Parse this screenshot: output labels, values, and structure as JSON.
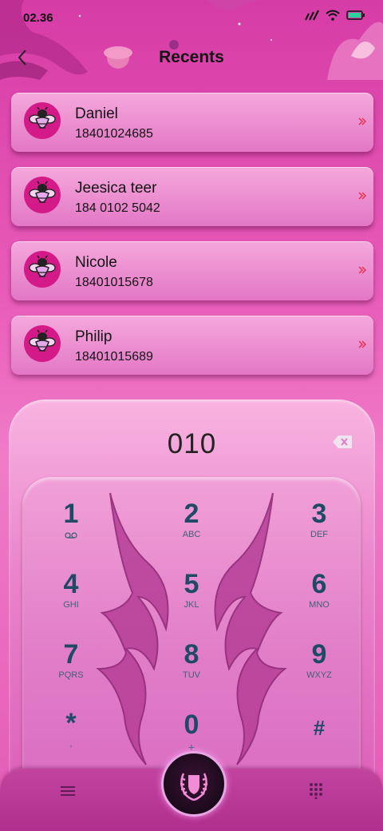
{
  "status_bar": {
    "time": "02.36"
  },
  "header": {
    "title": "Recents"
  },
  "recents": [
    {
      "name": "Daniel",
      "number": "18401024685"
    },
    {
      "name": "Jeesica teer",
      "number": "184 0102 5042"
    },
    {
      "name": "Nicole",
      "number": "18401015678"
    },
    {
      "name": "Philip",
      "number": "18401015689"
    }
  ],
  "dialer": {
    "input": "010",
    "keys": [
      {
        "digit": "1",
        "letters": ""
      },
      {
        "digit": "2",
        "letters": "ABC"
      },
      {
        "digit": "3",
        "letters": "DEF"
      },
      {
        "digit": "4",
        "letters": "GHI"
      },
      {
        "digit": "5",
        "letters": "JKL"
      },
      {
        "digit": "6",
        "letters": "MNO"
      },
      {
        "digit": "7",
        "letters": "PQRS"
      },
      {
        "digit": "8",
        "letters": "TUV"
      },
      {
        "digit": "9",
        "letters": "WXYZ"
      },
      {
        "digit": "*",
        "letters": ","
      },
      {
        "digit": "0",
        "letters": "+"
      },
      {
        "digit": "#",
        "letters": ""
      }
    ]
  },
  "icons": {
    "back": "chevron-left-icon",
    "contact_avatar": "bee-icon",
    "row_arrow": "double-chevron-right-icon",
    "backspace": "backspace-icon",
    "voicemail": "voicemail-icon",
    "menu": "menu-icon",
    "dialpad": "dialpad-icon",
    "call": "laurel-shield-icon"
  },
  "colors": {
    "accent": "#d31a88",
    "digit": "#1e4a66",
    "arrow": "#e8304f"
  }
}
